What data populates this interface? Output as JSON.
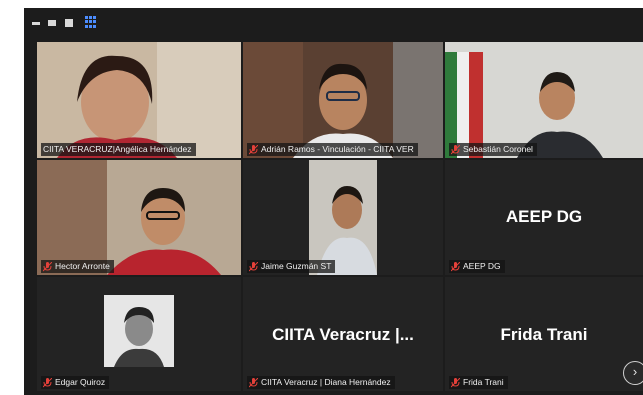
{
  "toolbar": {
    "icons": [
      "minimize-icon",
      "speaker-view-icon",
      "film-strip-icon",
      "gallery-grid-icon"
    ]
  },
  "participants": [
    {
      "label": "CIITA VERACRUZ|Angélica Hernández",
      "muted": false,
      "has_video": true
    },
    {
      "label": "Adrián Ramos - Vinculación - CIITA VER",
      "muted": true,
      "has_video": true
    },
    {
      "label": "Sebastián Coronel",
      "muted": true,
      "has_video": true
    },
    {
      "label": "Hector Arronte",
      "muted": true,
      "has_video": true
    },
    {
      "label": "Jaime Guzmán ST",
      "muted": true,
      "has_video": true
    },
    {
      "label": "AEEP DG",
      "muted": true,
      "has_video": false,
      "display_name": "AEEP DG"
    },
    {
      "label": "Edgar Quiroz",
      "muted": true,
      "has_video": false
    },
    {
      "label": "CIITA Veracruz | Diana Hernández",
      "muted": true,
      "has_video": false,
      "display_name": "CIITA Veracruz |..."
    },
    {
      "label": "Frida Trani",
      "muted": true,
      "has_video": false,
      "display_name": "Frida Trani"
    }
  ],
  "colors": {
    "mic_muted": "#e5413a",
    "active_speaker": "#b8d84a",
    "grid_icon": "#4c8dff"
  },
  "nav": {
    "next_label": "›"
  }
}
